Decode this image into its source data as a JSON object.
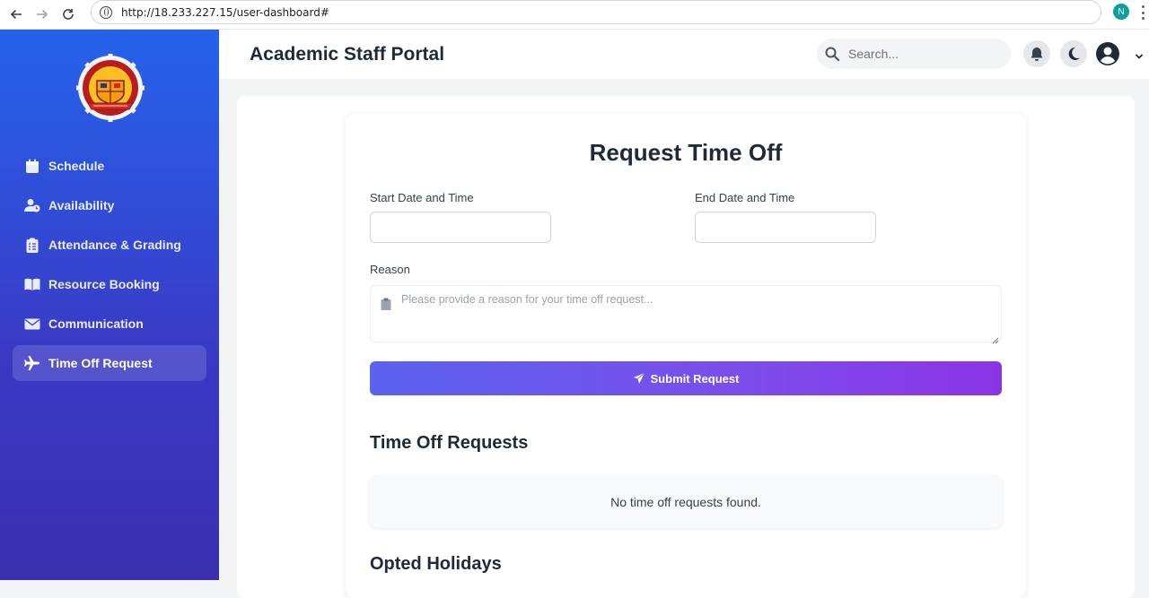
{
  "browser": {
    "url": "http://18.233.227.15/user-dashboard#",
    "profile_initial": "N"
  },
  "sidebar": {
    "items": [
      {
        "label": "Schedule",
        "icon": "calendar-icon",
        "active": false
      },
      {
        "label": "Availability",
        "icon": "user-clock-icon",
        "active": false
      },
      {
        "label": "Attendance & Grading",
        "icon": "clipboard-icon",
        "active": false
      },
      {
        "label": "Resource Booking",
        "icon": "book-icon",
        "active": false
      },
      {
        "label": "Communication",
        "icon": "envelope-icon",
        "active": false
      },
      {
        "label": "Time Off Request",
        "icon": "plane-icon",
        "active": true
      }
    ]
  },
  "header": {
    "title": "Academic Staff Portal",
    "search_placeholder": "Search..."
  },
  "form": {
    "title": "Request Time Off",
    "start_label": "Start Date and Time",
    "end_label": "End Date and Time",
    "start_value": "",
    "end_value": "",
    "reason_label": "Reason",
    "reason_placeholder": "Please provide a reason for your time off request...",
    "submit_label": "Submit Request"
  },
  "requests": {
    "title": "Time Off Requests",
    "empty_text": "No time off requests found."
  },
  "holidays": {
    "title": "Opted Holidays"
  },
  "colors": {
    "sidebar_top": "#2563eb",
    "sidebar_bottom": "#3b2fb0",
    "button_start": "#5b63ef",
    "button_end": "#8b34e6"
  }
}
